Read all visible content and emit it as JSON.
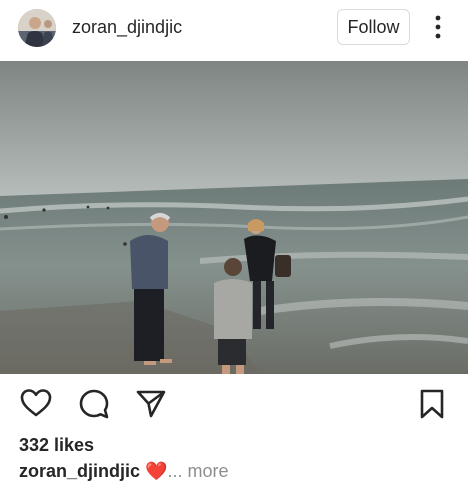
{
  "post": {
    "username": "zoran_djindjic",
    "follow_label": "Follow",
    "likes": "332 likes",
    "caption": {
      "username": "zoran_djindjic",
      "emoji": "❤️",
      "ellipsis": "...",
      "more_label": "more"
    },
    "photo_alt": "Family at the beach wading in the sea"
  },
  "icons": {
    "avatar": "profile-avatar",
    "more": "more-options-vertical-icon",
    "like": "heart-icon",
    "comment": "comment-bubble-icon",
    "share": "paper-plane-icon",
    "save": "bookmark-icon"
  },
  "colors": {
    "text": "#262626",
    "muted": "#8e8e8e",
    "border": "#dbdbdb",
    "heart": "#e0245e"
  }
}
